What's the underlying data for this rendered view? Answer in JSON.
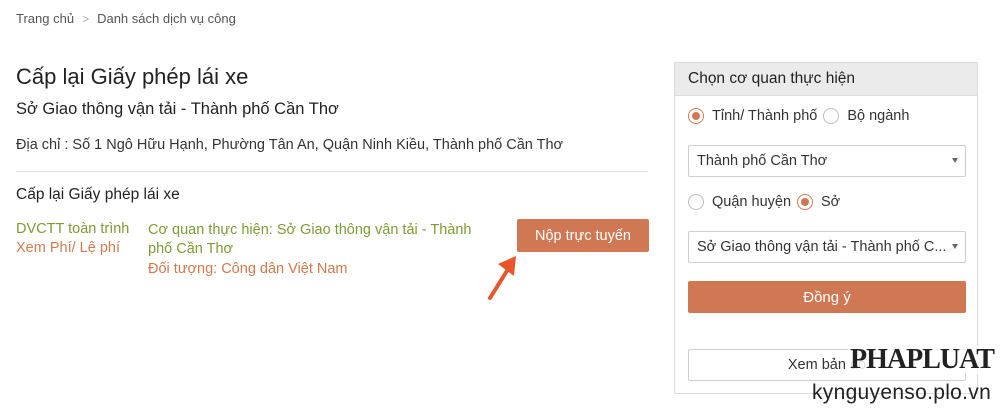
{
  "breadcrumb": {
    "home": "Trang chủ",
    "separator": ">",
    "current": "Danh sách dịch vụ công"
  },
  "service": {
    "title": "Cấp lại Giấy phép lái xe",
    "agency": "Sở Giao thông vận tải - Thành phố Cần Thơ",
    "address": "Địa chỉ : Số 1 Ngô Hữu Hạnh, Phường Tân An, Quận Ninh Kiều, Thành phố Cần Thơ",
    "section_title": "Cấp lại Giấy phép lái xe",
    "level_link": "DVCTT toàn trình",
    "fee_link": "Xem Phí/ Lệ phí",
    "agency_meta": "Cơ quan thực hiện: Sở Giao thông vận tải - Thành phố Cần Thơ",
    "target": "Đối tượng: Công dân Việt Nam",
    "submit_label": "Nộp trực tuyến"
  },
  "panel": {
    "title": "Chọn cơ quan thực hiện",
    "scope_options": [
      {
        "label": "Tỉnh/ Thành phố",
        "selected": true
      },
      {
        "label": "Bộ ngành",
        "selected": false
      }
    ],
    "province_select": "Thành phố Cần Thơ",
    "level_options": [
      {
        "label": "Quận huyện",
        "selected": false
      },
      {
        "label": "Sở",
        "selected": true
      }
    ],
    "agency_select": "Sở Giao thông vận tải - Thành phố C...",
    "agree_label": "Đồng ý",
    "map_label": "Xem bản đồ"
  },
  "annotation": {
    "arrow_icon": "red-arrow-icon",
    "arrow_color": "#e8552b"
  },
  "branding": {
    "logo": "PHAPLUAT",
    "site": "kynguyenso.plo.vn"
  },
  "colors": {
    "accent": "#cf7853",
    "green_link": "#7c9b34",
    "orange_link": "#d07a4e"
  }
}
